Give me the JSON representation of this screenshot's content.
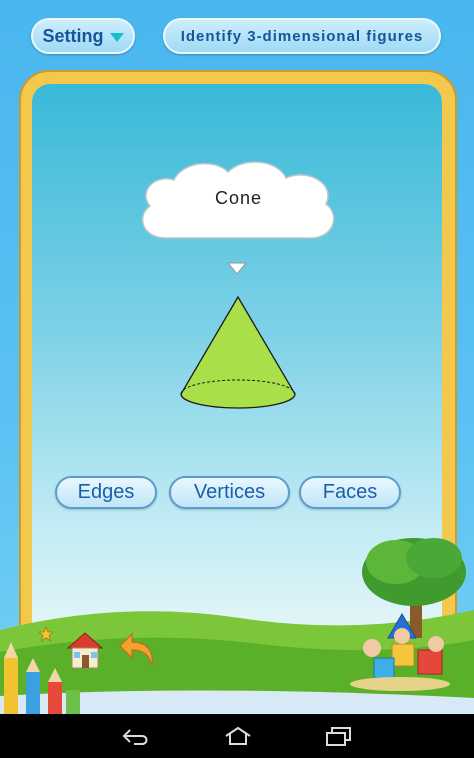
{
  "header": {
    "setting_label": "Setting",
    "title": "Identify 3-dimensional figures"
  },
  "question": {
    "figure_name": "Cone"
  },
  "answers": [
    {
      "label": "Edges"
    },
    {
      "label": "Vertices"
    },
    {
      "label": "Faces"
    }
  ],
  "toolbar": {
    "icons": [
      "star-icon",
      "home-icon",
      "back-arrow-icon"
    ]
  },
  "colors": {
    "shape_fill": "#a9e04a",
    "button_text": "#1b5fa8",
    "frame": "#f2c94c"
  },
  "system_nav": {
    "icons": [
      "nav-back-icon",
      "nav-home-icon",
      "nav-recents-icon"
    ]
  }
}
